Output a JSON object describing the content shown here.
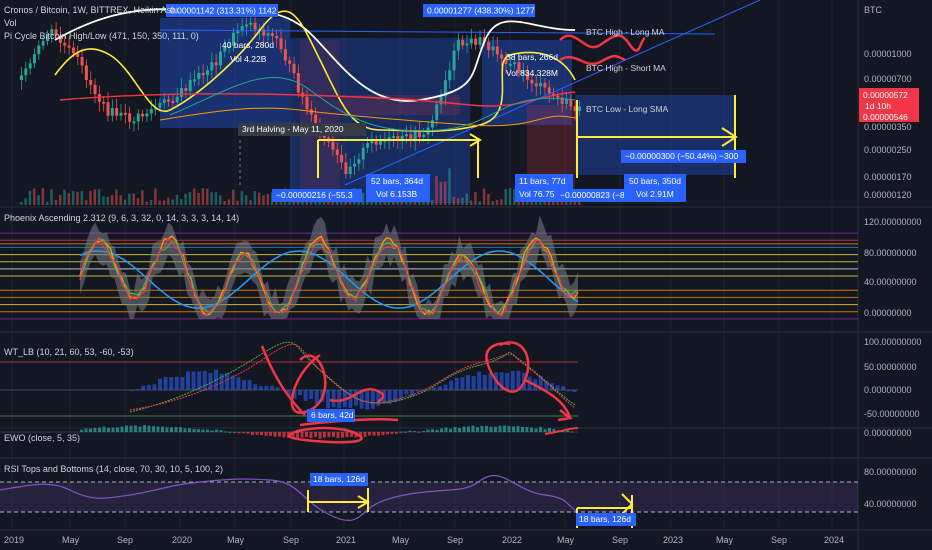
{
  "header": {
    "title": "Cronos / Bitcoin, 1W, BITTREX, Heikin Ashi",
    "vol_label": "Vol",
    "indicator": "Pi Cycle Bitcoin High/Low (471, 150, 350, 111, 0)"
  },
  "currency_label": "BTC",
  "colors": {
    "background": "#131722",
    "grid": "#1e222d",
    "blue_box": "#2962ff",
    "yellow": "#ffeb3b",
    "red": "#f23645",
    "white": "#ffffff",
    "green": "#26a69a",
    "purple": "#7e57c2"
  },
  "panels": {
    "phoenix": "Phoenix Ascending 2.312 (9, 6, 3, 32, 0, 14, 3, 3, 3, 14, 14)",
    "wt": "WT_LB (10, 21, 60, 53, -60, -53)",
    "ewo": "EWO (close, 5, 35)",
    "rsi": "RSI Tops and Bottoms (14, close, 70, 30, 10, 5, 100, 2)"
  },
  "price_labels": {
    "current": "0.00000572",
    "countdown": "1d 10h",
    "secondary": "0.00000546"
  },
  "annotations": {
    "a1": "0.00001142 (313.31%) 1142",
    "a2": "0.00001277 (438.30%) 1277",
    "a3": "40 bars, 280d",
    "a3v": "Vol 4.22B",
    "a4": "3rd Halving - May 11, 2020",
    "a5": "−0.00000216 (−55.3",
    "a6": "52 bars, 364d",
    "a6v": "Vol 6.153B",
    "a7": "38 bars, 266d",
    "a7v": "Vol 834.328M",
    "a8": "11 bars, 77d",
    "a8v": "Vol 76.75",
    "a9": "−0.00000823 (−86",
    "a10": "50 bars, 350d",
    "a10v": "Vol 2.91M",
    "a11": "−0.00000300 (−50.44%) −300",
    "btc_long": "BTC High - Long MA",
    "btc_short": "BTC High - Short MA",
    "btc_low": "BTC Low - Long SMA",
    "b1": "6 bars, 42d",
    "b2": "18 bars, 126d",
    "b3": "18 bars, 126d"
  },
  "chart_data": {
    "type": "line",
    "x_axis_labels": [
      "2019",
      "May",
      "Sep",
      "2020",
      "May",
      "Sep",
      "2021",
      "May",
      "Sep",
      "2022",
      "May",
      "Sep",
      "2023",
      "May",
      "Sep",
      "2024"
    ],
    "main": {
      "y_axis_labels": [
        "0.00001000",
        "0.00000700",
        "0.00000500",
        "0.00000350",
        "0.00000250",
        "0.00000170",
        "0.00000120"
      ],
      "series": [
        {
          "name": "BTC High - Long MA",
          "values": [
            4,
            4.5,
            5.5,
            6,
            6.5,
            7.5,
            9.5,
            11.5,
            13,
            13.2,
            12.8,
            12.5,
            12,
            11,
            9,
            7,
            6.5,
            7,
            8.5,
            10,
            11.5,
            12,
            12.5,
            12.3,
            12
          ]
        },
        {
          "name": "BTC High - Short MA",
          "values": [
            7,
            8,
            9.5,
            6,
            3.5,
            2,
            1.8,
            2,
            3,
            4.5,
            6,
            7.5,
            9,
            11,
            13,
            11,
            7,
            4,
            3.2,
            3,
            3.2,
            3.3,
            3.5,
            4.5,
            9,
            11,
            10.5,
            9.5
          ]
        },
        {
          "name": "BTC Low - Long SMA",
          "values": [
            5,
            5.2,
            5.4,
            5.5,
            5.5,
            5.4,
            5.3,
            5.1,
            4.8,
            4.5,
            4.2,
            4.0,
            3.9,
            3.8,
            3.7,
            3.6,
            3.6,
            3.7,
            3.9,
            4.2,
            4.6,
            5.0,
            5.3,
            5.5
          ]
        }
      ]
    },
    "phoenix": {
      "y_axis_labels": [
        "120.00000000",
        "80.00000000",
        "40.00000000",
        "0.00000000"
      ],
      "range": [
        -20,
        120
      ],
      "levels": [
        110,
        100,
        95,
        90,
        80,
        70,
        60,
        50,
        30,
        20,
        10,
        0,
        -10
      ]
    },
    "wt": {
      "y_axis_labels": [
        "100.00000000",
        "50.00000000",
        "0.00000000",
        "-50.00000000"
      ],
      "range": [
        -70,
        110
      ]
    },
    "ewo": {
      "y_axis_labels": [
        "0.00000000"
      ]
    },
    "rsi": {
      "y_axis_labels": [
        "80.00000000",
        "40.00000000"
      ],
      "range": [
        20,
        100
      ],
      "overbought": 70,
      "oversold": 30
    }
  }
}
